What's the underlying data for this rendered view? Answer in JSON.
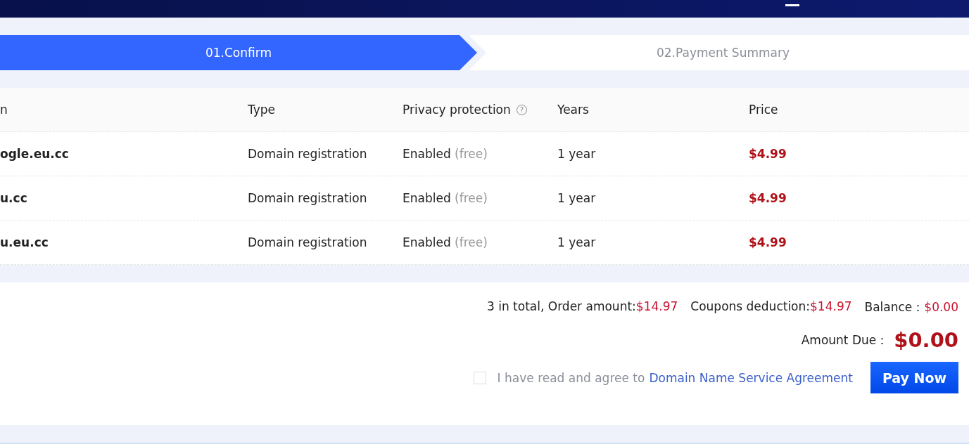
{
  "steps": [
    {
      "label": "01.Confirm",
      "selected": true
    },
    {
      "label": "02.Payment Summary",
      "selected": false
    }
  ],
  "table": {
    "columns": [
      {
        "label": "n"
      },
      {
        "label": "Type"
      },
      {
        "label": "Privacy protection",
        "help": "?"
      },
      {
        "label": "Years"
      },
      {
        "label": "Price"
      }
    ],
    "rows": [
      {
        "column_1": "ogle.eu.cc",
        "type": "Domain registration",
        "privacy": "Enabled",
        "privacy_note": "(free)",
        "years": "1 year",
        "price": "$4.99"
      },
      {
        "column_1": "u.cc",
        "type": "Domain registration",
        "privacy": "Enabled",
        "privacy_note": "(free)",
        "years": "1 year",
        "price": "$4.99"
      },
      {
        "column_1": "u.eu.cc",
        "type": "Domain registration",
        "privacy": "Enabled",
        "privacy_note": "(free)",
        "years": "1 year",
        "price": "$4.99"
      }
    ]
  },
  "summary": {
    "totals": [
      {
        "label": "3 in total, Order amount:",
        "value": "$14.97"
      },
      {
        "label": "Coupons deduction:",
        "value": "$14.97"
      },
      {
        "label": "Balance：",
        "value": "$0.00"
      }
    ],
    "amount_due_label": "Amount Due：",
    "amount_due": "$0.00",
    "agreement": {
      "checked": false,
      "text": "I have read and agree to",
      "link": "Domain Name Service Agreement"
    },
    "pay_button": "Pay Now"
  }
}
